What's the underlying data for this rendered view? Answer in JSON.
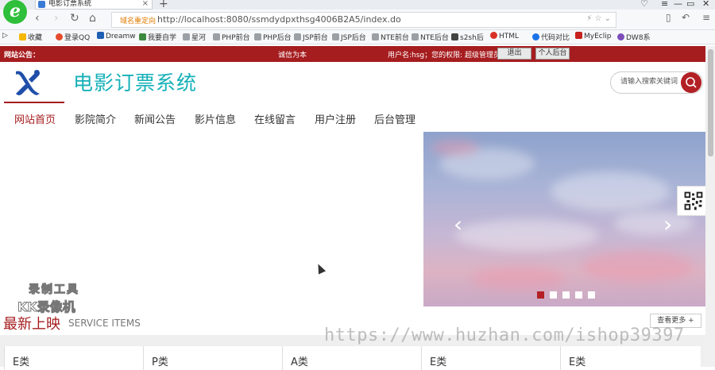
{
  "browser": {
    "tab_title": "电影订票系统",
    "url_tag": "域名重定向",
    "url": "http://localhost:8080/ssmdydpxthsg4006B2A5/index.do",
    "bookmarks": [
      "收藏",
      "登录QQ",
      "Dreamw",
      "我要自学",
      "星河",
      "PHP前台",
      "PHP后台",
      "JSP前台",
      "JSP后台",
      "NTE前台",
      "NTE后台",
      "s2sh后",
      "HTML",
      "代码对比",
      "MyEclip",
      "DW8系"
    ]
  },
  "notice": {
    "label": "网站公告：",
    "marquee": "诚信为本",
    "user_info": "用户名:hsg；您的权限: 超级管理员",
    "logout_label": "退出",
    "backend_label": "个人后台"
  },
  "header": {
    "title": "电影订票系统",
    "search_placeholder": "请输入搜索关键词"
  },
  "nav": {
    "items": [
      "网站首页",
      "影院简介",
      "新闻公告",
      "影片信息",
      "在线留言",
      "用户注册",
      "后台管理"
    ]
  },
  "watermark": {
    "line1": "录制工具",
    "line2": "KK录像机",
    "url_text": "https://www.huzhan.com/ishop39397"
  },
  "section": {
    "title": "最新上映",
    "subtitle": "SERVICE ITEMS",
    "more_label": "查看更多 +"
  },
  "categories": [
    "E类",
    "P类",
    "A类",
    "E类",
    "E类"
  ],
  "colors": {
    "brand_red": "#a61d1f",
    "title_teal": "#15b0b8"
  }
}
